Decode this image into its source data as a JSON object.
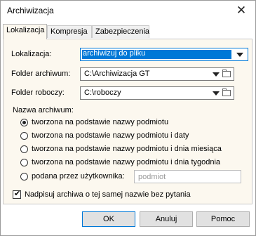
{
  "window": {
    "title": "Archiwizacja"
  },
  "icons": {
    "close": "close-icon",
    "dropdown": "chevron-down-icon",
    "folder": "folder-icon"
  },
  "tabs": [
    {
      "label": "Lokalizacja",
      "active": true
    },
    {
      "label": "Kompresja",
      "active": false
    },
    {
      "label": "Zabezpieczenia",
      "active": false
    }
  ],
  "form": {
    "location_label": "Lokalizacja:",
    "location_value": "archiwizuj do pliku",
    "archive_folder_label": "Folder archiwum:",
    "archive_folder_value": "C:\\Archiwizacja GT",
    "work_folder_label": "Folder roboczy:",
    "work_folder_value": "C:\\roboczy",
    "archive_name_group": "Nazwa archiwum:",
    "options": [
      {
        "label": "tworzona na podstawie nazwy podmiotu",
        "selected": true
      },
      {
        "label": "tworzona na podstawie nazwy podmiotu i daty",
        "selected": false
      },
      {
        "label": "tworzona na podstawie nazwy podmiotu i dnia miesiąca",
        "selected": false
      },
      {
        "label": "tworzona na podstawie nazwy podmiotu i dnia tygodnia",
        "selected": false
      },
      {
        "label": "podana przez użytkownika:",
        "selected": false
      }
    ],
    "custom_name_placeholder": "podmiot",
    "overwrite_label": "Nadpisuj archiwa o tej samej nazwie bez pytania",
    "overwrite_checked": true
  },
  "buttons": {
    "ok": "OK",
    "cancel": "Anuluj",
    "help": "Pomoc"
  },
  "colors": {
    "selection": "#0078d7",
    "panel_background": "#fcf8ef"
  }
}
